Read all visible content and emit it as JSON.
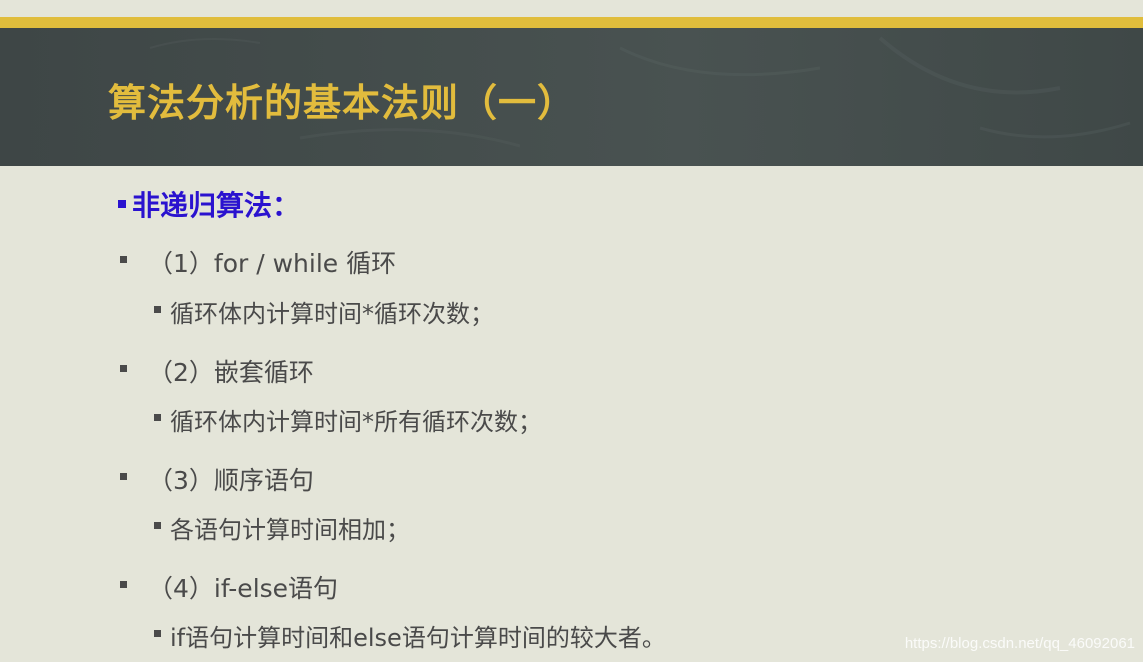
{
  "slide": {
    "title": "算法分析的基本法则（一）",
    "heading": "非递归算法：",
    "rules": [
      {
        "label": "（1）for / while 循环",
        "detail": "循环体内计算时间*循环次数；"
      },
      {
        "label": "（2）嵌套循环",
        "detail": "循环体内计算时间*所有循环次数；"
      },
      {
        "label": "（3）顺序语句",
        "detail": "各语句计算时间相加；"
      },
      {
        "label": "（4）if-else语句",
        "detail": "if语句计算时间和else语句计算时间的较大者。"
      }
    ],
    "watermark": "https://blog.csdn.net/qq_46092061"
  },
  "colors": {
    "header_bg": "#434c4b",
    "gold": "#e0bd3c",
    "title": "#e2bc3d",
    "heading": "#2a12cf",
    "body_bg": "#e4e5d9",
    "text": "#4a4a4a"
  }
}
